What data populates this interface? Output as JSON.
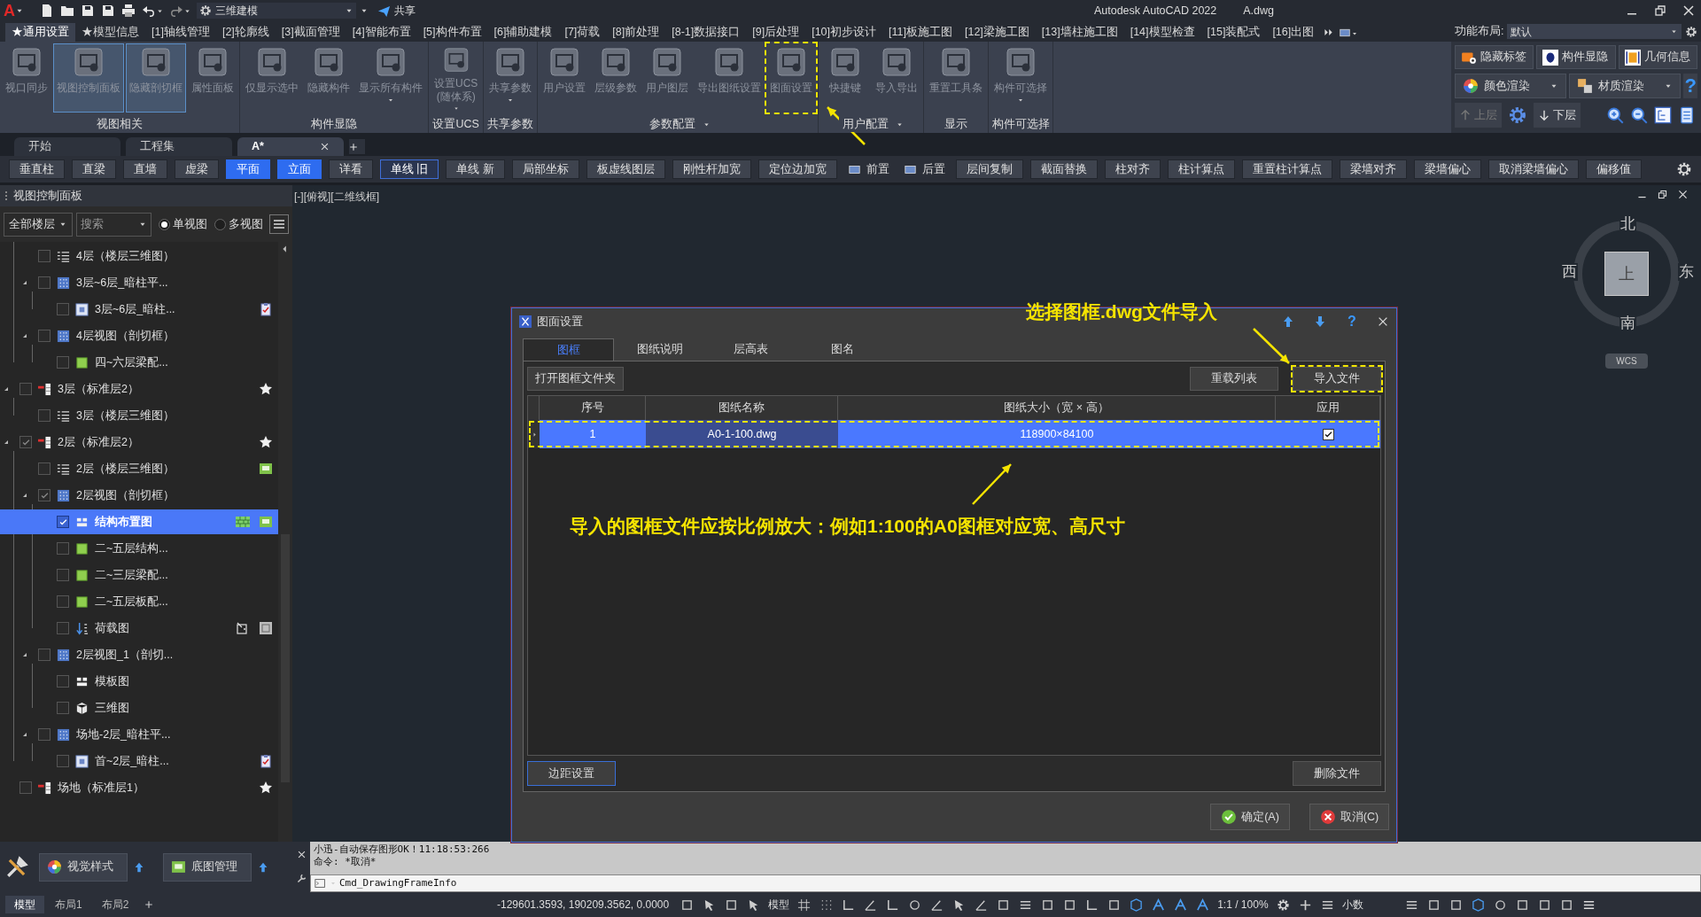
{
  "title_bar": {
    "app_menu": "A",
    "workspace": "三维建模",
    "share": "共享",
    "title": "Autodesk AutoCAD 2022",
    "file": "A.dwg"
  },
  "menu_tabs": [
    {
      "label": "★通用设置",
      "selected": true
    },
    {
      "label": "★模型信息",
      "selected": false
    },
    {
      "label": "[1]轴线管理",
      "selected": false
    },
    {
      "label": "[2]轮廓线",
      "selected": false
    },
    {
      "label": "[3]截面管理",
      "selected": false
    },
    {
      "label": "[4]智能布置",
      "selected": false
    },
    {
      "label": "[5]构件布置",
      "selected": false
    },
    {
      "label": "[6]辅助建模",
      "selected": false
    },
    {
      "label": "[7]荷载",
      "selected": false
    },
    {
      "label": "[8]前处理",
      "selected": false
    },
    {
      "label": "[8-1]数据接口",
      "selected": false
    },
    {
      "label": "[9]后处理",
      "selected": false
    },
    {
      "label": "[10]初步设计",
      "selected": false
    },
    {
      "label": "[11]板施工图",
      "selected": false
    },
    {
      "label": "[12]梁施工图",
      "selected": false
    },
    {
      "label": "[13]墙柱施工图",
      "selected": false
    },
    {
      "label": "[14]模型检查",
      "selected": false
    },
    {
      "label": "[15]装配式",
      "selected": false
    },
    {
      "label": "[16]出图",
      "selected": false
    }
  ],
  "layout_selector": {
    "label": "功能布局:",
    "value": "默认"
  },
  "ribbon_panels": [
    {
      "title": "视图相关",
      "dropdown": false,
      "buttons": [
        {
          "label": "视口同步",
          "selected": false,
          "dropdown": false,
          "marked": false
        },
        {
          "label": "视图控制面板",
          "selected": true,
          "dropdown": false,
          "marked": false
        },
        {
          "label": "隐藏剖切框",
          "selected": true,
          "dropdown": false,
          "marked": false
        },
        {
          "label": "属性面板",
          "selected": false,
          "dropdown": false,
          "marked": false
        }
      ]
    },
    {
      "title": "构件显隐",
      "dropdown": false,
      "buttons": [
        {
          "label": "仅显示选中",
          "selected": false,
          "dropdown": false,
          "marked": false
        },
        {
          "label": "隐藏构件",
          "selected": false,
          "dropdown": false,
          "marked": false
        },
        {
          "label": "显示所有构件",
          "selected": false,
          "dropdown": true,
          "marked": false
        }
      ]
    },
    {
      "title": "设置UCS",
      "dropdown": false,
      "buttons": [
        {
          "label": "设置UCS\n(随体系)",
          "selected": false,
          "dropdown": true,
          "marked": false
        }
      ]
    },
    {
      "title": "共享参数",
      "dropdown": false,
      "buttons": [
        {
          "label": "共享参数",
          "selected": false,
          "dropdown": true,
          "marked": false
        }
      ]
    },
    {
      "title": "参数配置",
      "dropdown": true,
      "buttons": [
        {
          "label": "用户设置",
          "selected": false,
          "dropdown": false,
          "marked": false
        },
        {
          "label": "层级参数",
          "selected": false,
          "dropdown": false,
          "marked": false
        },
        {
          "label": "用户图层",
          "selected": false,
          "dropdown": false,
          "marked": false
        },
        {
          "label": "导出图纸设置",
          "selected": false,
          "dropdown": false,
          "marked": false
        },
        {
          "label": "图面设置",
          "selected": false,
          "dropdown": false,
          "marked": true
        }
      ]
    },
    {
      "title": "用户配置",
      "dropdown": true,
      "buttons": [
        {
          "label": "快捷键",
          "selected": false,
          "dropdown": false,
          "marked": false
        },
        {
          "label": "导入导出",
          "selected": false,
          "dropdown": false,
          "marked": false
        }
      ]
    },
    {
      "title": "显示",
      "dropdown": false,
      "buttons": [
        {
          "label": "重置工具条",
          "selected": false,
          "dropdown": false,
          "marked": false
        }
      ]
    },
    {
      "title": "构件可选择",
      "dropdown": false,
      "buttons": [
        {
          "label": "构件可选择",
          "selected": false,
          "dropdown": true,
          "marked": false
        }
      ]
    }
  ],
  "ribbon_side": {
    "row_1": [
      {
        "label": "隐藏标签"
      },
      {
        "label": "构件显隐"
      },
      {
        "label": "几何信息"
      }
    ],
    "row_2": [
      {
        "label": "颜色渲染"
      },
      {
        "label": "材质渲染"
      }
    ],
    "help": "?",
    "up": {
      "label": "上层",
      "disabled": true
    },
    "down": {
      "label": "下层",
      "disabled": false
    }
  },
  "doc_tabs": [
    {
      "label": "开始",
      "selected": false,
      "closable": false
    },
    {
      "label": "工程集",
      "selected": false,
      "closable": false
    },
    {
      "label": "A*",
      "selected": true,
      "closable": true
    }
  ],
  "toolbar": [
    {
      "label": "垂直柱",
      "kind": "button",
      "selected": false,
      "focused": false
    },
    {
      "label": "直梁",
      "kind": "button",
      "selected": false,
      "focused": false
    },
    {
      "label": "直墙",
      "kind": "button",
      "selected": false,
      "focused": false
    },
    {
      "label": "虚梁",
      "kind": "button",
      "selected": false,
      "focused": false
    },
    {
      "label": "平面",
      "kind": "button",
      "selected": true,
      "focused": false
    },
    {
      "label": "立面",
      "kind": "button",
      "selected": true,
      "focused": false
    },
    {
      "label": "详看",
      "kind": "button",
      "selected": false,
      "focused": false
    },
    {
      "label": "单线 旧",
      "kind": "button",
      "selected": false,
      "focused": true
    },
    {
      "label": "单线 新",
      "kind": "button",
      "selected": false,
      "focused": false
    },
    {
      "label": "局部坐标",
      "kind": "button",
      "selected": false,
      "focused": false
    },
    {
      "label": "板虚线图层",
      "kind": "button",
      "selected": false,
      "focused": false
    },
    {
      "label": "刚性杆加宽",
      "kind": "button",
      "selected": false,
      "focused": false
    },
    {
      "label": "定位边加宽",
      "kind": "button",
      "selected": false,
      "focused": false
    },
    {
      "label": "前置",
      "kind": "icon",
      "selected": false,
      "focused": false
    },
    {
      "label": "后置",
      "kind": "icon",
      "selected": false,
      "focused": false
    },
    {
      "label": "层间复制",
      "kind": "button",
      "selected": false,
      "focused": false
    },
    {
      "label": "截面替换",
      "kind": "button",
      "selected": false,
      "focused": false
    },
    {
      "label": "柱对齐",
      "kind": "button",
      "selected": false,
      "focused": false
    },
    {
      "label": "柱计算点",
      "kind": "button",
      "selected": false,
      "focused": false
    },
    {
      "label": "重置柱计算点",
      "kind": "button",
      "selected": false,
      "focused": false
    },
    {
      "label": "梁墙对齐",
      "kind": "button",
      "selected": false,
      "focused": false
    },
    {
      "label": "梁墙偏心",
      "kind": "button",
      "selected": false,
      "focused": false
    },
    {
      "label": "取消梁墙偏心",
      "kind": "button",
      "selected": false,
      "focused": false
    },
    {
      "label": "偏移值",
      "kind": "button",
      "selected": false,
      "focused": false
    }
  ],
  "view_panel": {
    "title": "视图控制面板",
    "floor_filter": "全部楼层",
    "search": {
      "placeholder": "搜索"
    },
    "view_modes": [
      {
        "label": "单视图",
        "selected": true
      },
      {
        "label": "多视图",
        "selected": false
      }
    ],
    "tree": [
      {
        "children": [
          {
            "label": "4层（楼层三维图）",
            "kind": "rows",
            "checked": false,
            "selected": false
          },
          {
            "label": "3层~6层_暗柱平...",
            "kind": "dots",
            "checked": false,
            "selected": false,
            "children": [
              {
                "label": "3层~6层_暗柱...",
                "kind": "framed",
                "checked": false,
                "selected": false
              }
            ]
          },
          {
            "label": "4层视图（剖切框）",
            "kind": "dots",
            "checked": false,
            "selected": false,
            "children": [
              {
                "label": "四~六层梁配...",
                "kind": "green",
                "checked": false,
                "selected": false
              }
            ]
          }
        ]
      },
      {
        "label": "3层（标准层2）",
        "kind": "floor",
        "checked": false,
        "selected": false,
        "children": [
          {
            "label": "3层（楼层三维图）",
            "kind": "rows",
            "checked": false,
            "selected": false
          }
        ]
      },
      {
        "label": "2层（标准层2）",
        "kind": "floor",
        "checked": true,
        "selected": false,
        "children": [
          {
            "label": "2层（楼层三维图）",
            "kind": "rows",
            "checked": false,
            "selected": false
          },
          {
            "label": "2层视图（剖切框）",
            "kind": "dots",
            "checked": true,
            "selected": false,
            "children": [
              {
                "label": "结构布置图",
                "kind": "blocks",
                "checked": true,
                "selected": true
              },
              {
                "label": "二~五层结构...",
                "kind": "green",
                "checked": false,
                "selected": false
              },
              {
                "label": "二~三层梁配...",
                "kind": "green",
                "checked": false,
                "selected": false
              },
              {
                "label": "二~五层板配...",
                "kind": "green",
                "checked": false,
                "selected": false
              },
              {
                "label": "荷载图",
                "kind": "load",
                "checked": false,
                "selected": false
              }
            ]
          },
          {
            "label": "2层视图_1（剖切...",
            "kind": "dots",
            "checked": false,
            "selected": false,
            "children": [
              {
                "label": "模板图",
                "kind": "blocks",
                "checked": false,
                "selected": false
              },
              {
                "label": "三维图",
                "kind": "cube",
                "checked": false,
                "selected": false
              }
            ]
          },
          {
            "label": "场地-2层_暗柱平...",
            "kind": "dots",
            "checked": false,
            "selected": false,
            "children": [
              {
                "label": "首~2层_暗柱...",
                "kind": "framed",
                "checked": false,
                "selected": false
              }
            ]
          }
        ]
      },
      {
        "label": "场地（标准层1）",
        "kind": "floor",
        "checked": false,
        "selected": false
      }
    ]
  },
  "viewport": {
    "label": "[-][俯视][二维线框]",
    "compass": {
      "north": "北",
      "west": "西",
      "east": "东",
      "south": "南",
      "center": "上",
      "ucs": "WCS"
    }
  },
  "dialog": {
    "title": "图面设置",
    "help": "?",
    "tabs": [
      {
        "label": "图框",
        "selected": true
      },
      {
        "label": "图纸说明",
        "selected": false
      },
      {
        "label": "层高表",
        "selected": false
      },
      {
        "label": "图名",
        "selected": false
      }
    ],
    "top_buttons": [
      {
        "label": "打开图框文件夹",
        "marked": false
      },
      {
        "label": "重载列表",
        "marked": false
      },
      {
        "label": "导入文件",
        "marked": true
      }
    ],
    "columns": [
      "序号",
      "图纸名称",
      "图纸大小（宽 × 高）",
      "应用"
    ],
    "rows": [
      {
        "number": "1",
        "name": "A0-1-100.dwg",
        "size": "118900×84100",
        "applied": true,
        "selected": true,
        "marked": true
      }
    ],
    "bottom_buttons": [
      {
        "label": "边距设置",
        "focused": true
      },
      {
        "label": "删除文件",
        "focused": false
      }
    ],
    "actions": [
      {
        "label": "确定(A)",
        "kind": "ok"
      },
      {
        "label": "取消(C)",
        "kind": "cancel"
      }
    ]
  },
  "annotations": [
    {
      "kind": "note",
      "text": "选择图框.dwg文件导入"
    },
    {
      "kind": "note",
      "text": "导入的图框文件应按比例放大：例如1:100的A0图框对应宽、高尺寸"
    }
  ],
  "bottom_tools": [
    {
      "label": "视觉样式"
    },
    {
      "label": "底图管理"
    }
  ],
  "command": {
    "history": [
      "小迅-自动保存图形OK！11:18:53:266",
      "命令: *取消*"
    ],
    "input": "Cmd_DrawingFrameInfo"
  },
  "status_bar": {
    "layouts": [
      {
        "label": "模型",
        "selected": true
      },
      {
        "label": "布局1",
        "selected": false
      },
      {
        "label": "布局2",
        "selected": false
      }
    ],
    "coordinates": "-129601.3593, 190209.3562, 0.0000",
    "space": "模型",
    "scale": "1:1 / 100%",
    "units": "小数"
  }
}
